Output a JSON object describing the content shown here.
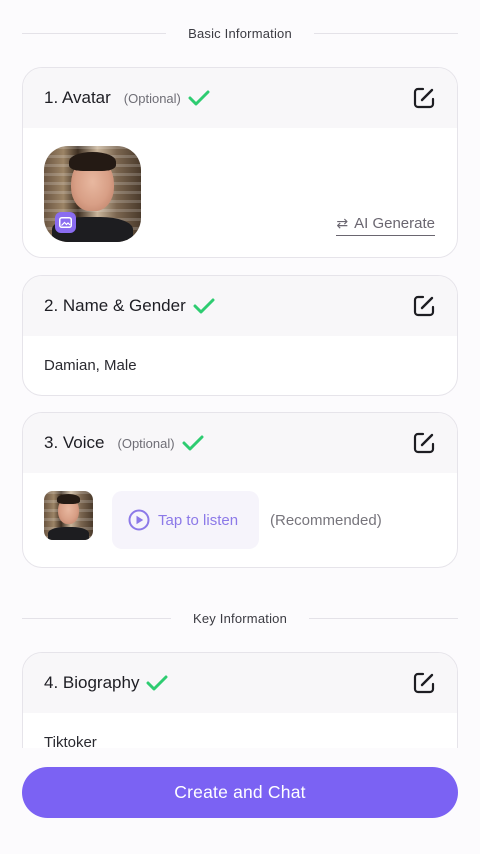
{
  "sections": {
    "basic": "Basic Information",
    "key": "Key Information"
  },
  "cards": {
    "avatar": {
      "title": "1. Avatar",
      "optional": "(Optional)",
      "ai_generate": "AI Generate"
    },
    "name_gender": {
      "title": "2. Name & Gender",
      "value": "Damian, Male"
    },
    "voice": {
      "title": "3. Voice",
      "optional": "(Optional)",
      "tap_to_listen": "Tap to listen",
      "recommended": "(Recommended)"
    },
    "biography": {
      "title": "4. Biography",
      "value": "Tiktoker"
    }
  },
  "actions": {
    "create_and_chat": "Create and Chat"
  },
  "colors": {
    "accent": "#7b62f3",
    "check": "#2ecc71",
    "listen": "#8c79e8"
  },
  "icons": {
    "check": "check-icon",
    "edit": "edit-icon",
    "play": "play-icon",
    "swap": "swap-icon",
    "image_badge": "image-icon"
  }
}
